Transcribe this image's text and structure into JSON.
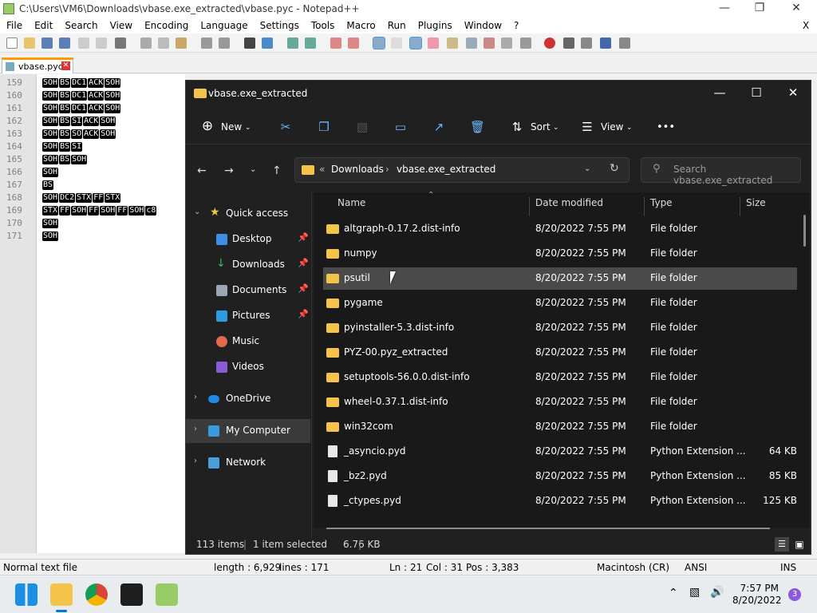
{
  "npp": {
    "title": "C:\\Users\\VM6\\Downloads\\vbase.exe_extracted\\vbase.pyc - Notepad++",
    "menu": [
      "File",
      "Edit",
      "Search",
      "View",
      "Encoding",
      "Language",
      "Settings",
      "Tools",
      "Macro",
      "Run",
      "Plugins",
      "Window",
      "?"
    ],
    "close_x": "X",
    "tab_label": "vbase.pyc",
    "lines": [
      {
        "num": "159",
        "tokens": [
          "SOH",
          "BS",
          "DC1",
          "ACK",
          "SOH"
        ]
      },
      {
        "num": "160",
        "tokens": [
          "SOH",
          "BS",
          "DC1",
          "ACK",
          "SOH"
        ]
      },
      {
        "num": "161",
        "tokens": [
          "SOH",
          "BS",
          "DC1",
          "ACK",
          "SOH"
        ]
      },
      {
        "num": "162",
        "tokens": [
          "SOH",
          "BS",
          "SI",
          "ACK",
          "SOH"
        ]
      },
      {
        "num": "163",
        "tokens": [
          "SOH",
          "BS",
          "SO",
          "ACK",
          "SOH"
        ]
      },
      {
        "num": "164",
        "tokens": [
          "SOH",
          "BS",
          "SI"
        ]
      },
      {
        "num": "165",
        "tokens": [
          "SOH",
          "BS",
          "SOH"
        ]
      },
      {
        "num": "166",
        "tokens": [
          "SOH"
        ]
      },
      {
        "num": "167",
        "tokens": [
          "BS"
        ]
      },
      {
        "num": "168",
        "tokens": [
          "SOH",
          "DC2",
          "STX",
          "FF",
          "STX"
        ]
      },
      {
        "num": "169",
        "tokens": [
          "STX",
          "FF",
          "SOH",
          "FF",
          "SOH",
          "FF",
          "SOH",
          "c8"
        ]
      },
      {
        "num": "170",
        "tokens": [
          "SOH"
        ]
      },
      {
        "num": "171",
        "tokens": [
          "SOH"
        ]
      }
    ],
    "status": {
      "type": "Normal text file",
      "length": "length : 6,929",
      "lines": "lines : 171",
      "ln": "Ln : 21",
      "col": "Col : 31",
      "pos": "Pos : 3,383",
      "eol": "Macintosh (CR)",
      "enc": "ANSI",
      "ins": "INS"
    }
  },
  "explorer": {
    "title": "vbase.exe_extracted",
    "new_label": "New",
    "sort_label": "Sort",
    "view_label": "View",
    "more": "•••",
    "address": {
      "sep": "«",
      "crumb1": "Downloads",
      "arrow": "›",
      "crumb2": "vbase.exe_extracted"
    },
    "search_placeholder": "Search vbase.exe_extracted",
    "nav": {
      "quick_access": "Quick access",
      "desktop": "Desktop",
      "downloads": "Downloads",
      "documents": "Documents",
      "pictures": "Pictures",
      "music": "Music",
      "videos": "Videos",
      "onedrive": "OneDrive",
      "my_computer": "My Computer",
      "network": "Network"
    },
    "columns": {
      "name": "Name",
      "date": "Date modified",
      "type": "Type",
      "size": "Size"
    },
    "rows": [
      {
        "name": "altgraph-0.17.2.dist-info",
        "date": "8/20/2022 7:55 PM",
        "type": "File folder",
        "size": "",
        "kind": "folder"
      },
      {
        "name": "numpy",
        "date": "8/20/2022 7:55 PM",
        "type": "File folder",
        "size": "",
        "kind": "folder"
      },
      {
        "name": "psutil",
        "date": "8/20/2022 7:55 PM",
        "type": "File folder",
        "size": "",
        "kind": "folder"
      },
      {
        "name": "pygame",
        "date": "8/20/2022 7:55 PM",
        "type": "File folder",
        "size": "",
        "kind": "folder"
      },
      {
        "name": "pyinstaller-5.3.dist-info",
        "date": "8/20/2022 7:55 PM",
        "type": "File folder",
        "size": "",
        "kind": "folder"
      },
      {
        "name": "PYZ-00.pyz_extracted",
        "date": "8/20/2022 7:55 PM",
        "type": "File folder",
        "size": "",
        "kind": "folder"
      },
      {
        "name": "setuptools-56.0.0.dist-info",
        "date": "8/20/2022 7:55 PM",
        "type": "File folder",
        "size": "",
        "kind": "folder"
      },
      {
        "name": "wheel-0.37.1.dist-info",
        "date": "8/20/2022 7:55 PM",
        "type": "File folder",
        "size": "",
        "kind": "folder"
      },
      {
        "name": "win32com",
        "date": "8/20/2022 7:55 PM",
        "type": "File folder",
        "size": "",
        "kind": "folder"
      },
      {
        "name": "_asyncio.pyd",
        "date": "8/20/2022 7:55 PM",
        "type": "Python Extension ...",
        "size": "64 KB",
        "kind": "file"
      },
      {
        "name": "_bz2.pyd",
        "date": "8/20/2022 7:55 PM",
        "type": "Python Extension ...",
        "size": "85 KB",
        "kind": "file"
      },
      {
        "name": "_ctypes.pyd",
        "date": "8/20/2022 7:55 PM",
        "type": "Python Extension ...",
        "size": "125 KB",
        "kind": "file"
      }
    ],
    "status": {
      "items": "113 items",
      "sep": "|",
      "selected": "1 item selected",
      "size": "6.76 KB",
      "sep2": "|"
    }
  },
  "taskbar": {
    "time": "7:57 PM",
    "date": "8/20/2022",
    "badge": "3"
  }
}
